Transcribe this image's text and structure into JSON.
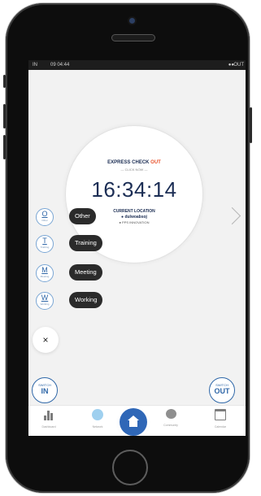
{
  "status_bar": {
    "left": "IN",
    "time": "09 04:44",
    "right_indicator": "●●",
    "right_label": "OUT"
  },
  "express": {
    "prefix": "EXPRESS CHECK ",
    "accent": "OUT",
    "click_now": "— CLICK NOW —"
  },
  "clock": {
    "time": "16:34:14"
  },
  "location": {
    "label": "CURRENT LOCATION",
    "name": "● dulwoabsoj",
    "org": "● PPS INNOVATION"
  },
  "activities": [
    {
      "letter": "O",
      "sub": "Other",
      "label": "Other"
    },
    {
      "letter": "T",
      "sub": "Training",
      "label": "Training"
    },
    {
      "letter": "M",
      "sub": "Meeting",
      "label": "Meeting"
    },
    {
      "letter": "W",
      "sub": "Working",
      "label": "Working"
    }
  ],
  "close_label": "×",
  "switch_in": {
    "top": "SWITCH",
    "bottom": "IN"
  },
  "switch_out": {
    "top": "SWITCH",
    "bottom": "OUT"
  },
  "tabs": [
    {
      "label": "Dashboard",
      "icon": "bar-chart-icon"
    },
    {
      "label": "Network",
      "icon": "sphere-icon"
    },
    {
      "label": "Home",
      "icon": "home-icon"
    },
    {
      "label": "Community",
      "icon": "chat-icon"
    },
    {
      "label": "Calendar",
      "icon": "calendar-icon"
    }
  ],
  "colors": {
    "primary": "#2f67b7",
    "navy": "#1c2e55",
    "accent": "#e8512a",
    "pill": "#2b2b2b"
  }
}
